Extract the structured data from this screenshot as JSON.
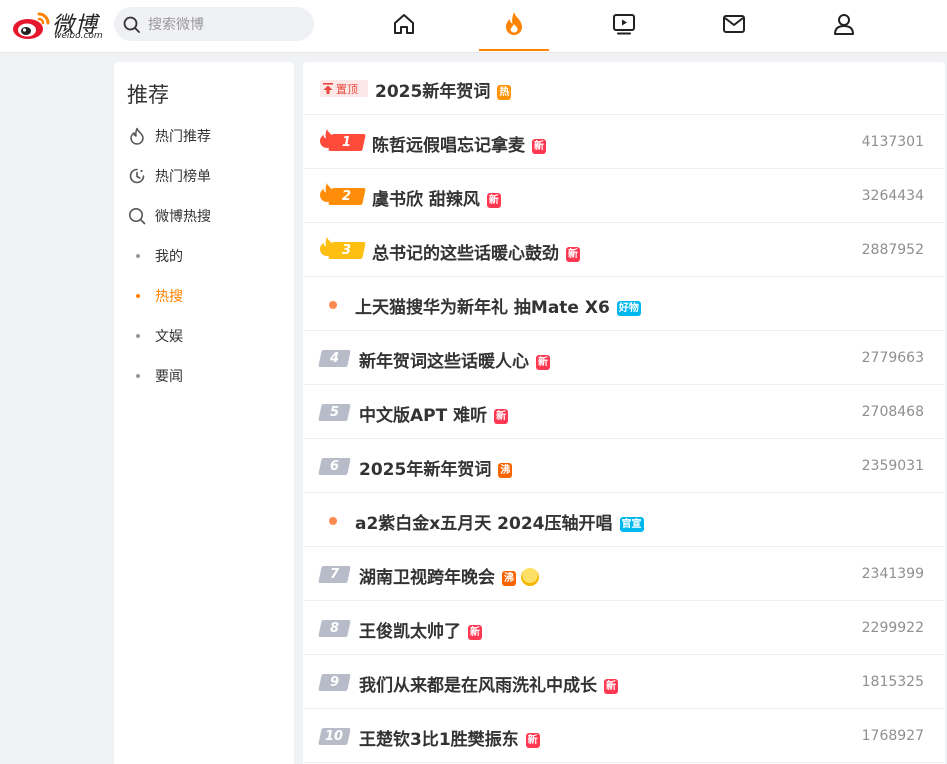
{
  "brand": {
    "logo_text": "微博",
    "logo_sub": "weibo.com",
    "accent": "#ff8200"
  },
  "search": {
    "placeholder": "搜索微博"
  },
  "nav": [
    {
      "name": "home",
      "icon": "home-icon"
    },
    {
      "name": "hot",
      "icon": "flame-icon",
      "active": true
    },
    {
      "name": "video",
      "icon": "video-icon"
    },
    {
      "name": "messages",
      "icon": "mail-icon"
    },
    {
      "name": "profile",
      "icon": "user-icon"
    }
  ],
  "sidebar": {
    "title": "推荐",
    "items": [
      {
        "label": "热门推荐",
        "icon": "flame-outline-icon"
      },
      {
        "label": "热门榜单",
        "icon": "clock-icon"
      },
      {
        "label": "微博热搜",
        "icon": "search-icon"
      }
    ],
    "sub_items": [
      {
        "label": "我的",
        "active": false
      },
      {
        "label": "热搜",
        "active": true
      },
      {
        "label": "文娱",
        "active": false
      },
      {
        "label": "要闻",
        "active": false
      }
    ]
  },
  "hotlist": {
    "pinned": {
      "tag": "置顶",
      "title": "2025新年贺词",
      "badge": "热"
    },
    "rows": [
      {
        "rank": "1",
        "title": "陈哲远假唱忘记拿麦",
        "badge": "新",
        "count": "4137301"
      },
      {
        "rank": "2",
        "title": "虞书欣 甜辣风",
        "badge": "新",
        "count": "3264434"
      },
      {
        "rank": "3",
        "title": "总书记的这些话暖心鼓劲",
        "badge": "新",
        "count": "2887952"
      },
      {
        "rank": "",
        "title": "上天猫搜华为新年礼 抽Mate X6",
        "badge": "好物",
        "count": ""
      },
      {
        "rank": "4",
        "title": "新年贺词这些话暖人心",
        "badge": "新",
        "count": "2779663"
      },
      {
        "rank": "5",
        "title": "中文版APT 难听",
        "badge": "新",
        "count": "2708468"
      },
      {
        "rank": "6",
        "title": "2025年新年贺词",
        "badge": "沸",
        "count": "2359031"
      },
      {
        "rank": "",
        "title": "a2紫白金x五月天 2024压轴开唱",
        "badge": "官宣",
        "count": ""
      },
      {
        "rank": "7",
        "title": "湖南卫视跨年晚会",
        "badge": "沸",
        "count": "2341399"
      },
      {
        "rank": "8",
        "title": "王俊凯太帅了",
        "badge": "新",
        "count": "2299922"
      },
      {
        "rank": "9",
        "title": "我们从来都是在风雨洗礼中成长",
        "badge": "新",
        "count": "1815325"
      },
      {
        "rank": "10",
        "title": "王楚钦3比1胜樊振东",
        "badge": "新",
        "count": "1768927"
      }
    ]
  }
}
